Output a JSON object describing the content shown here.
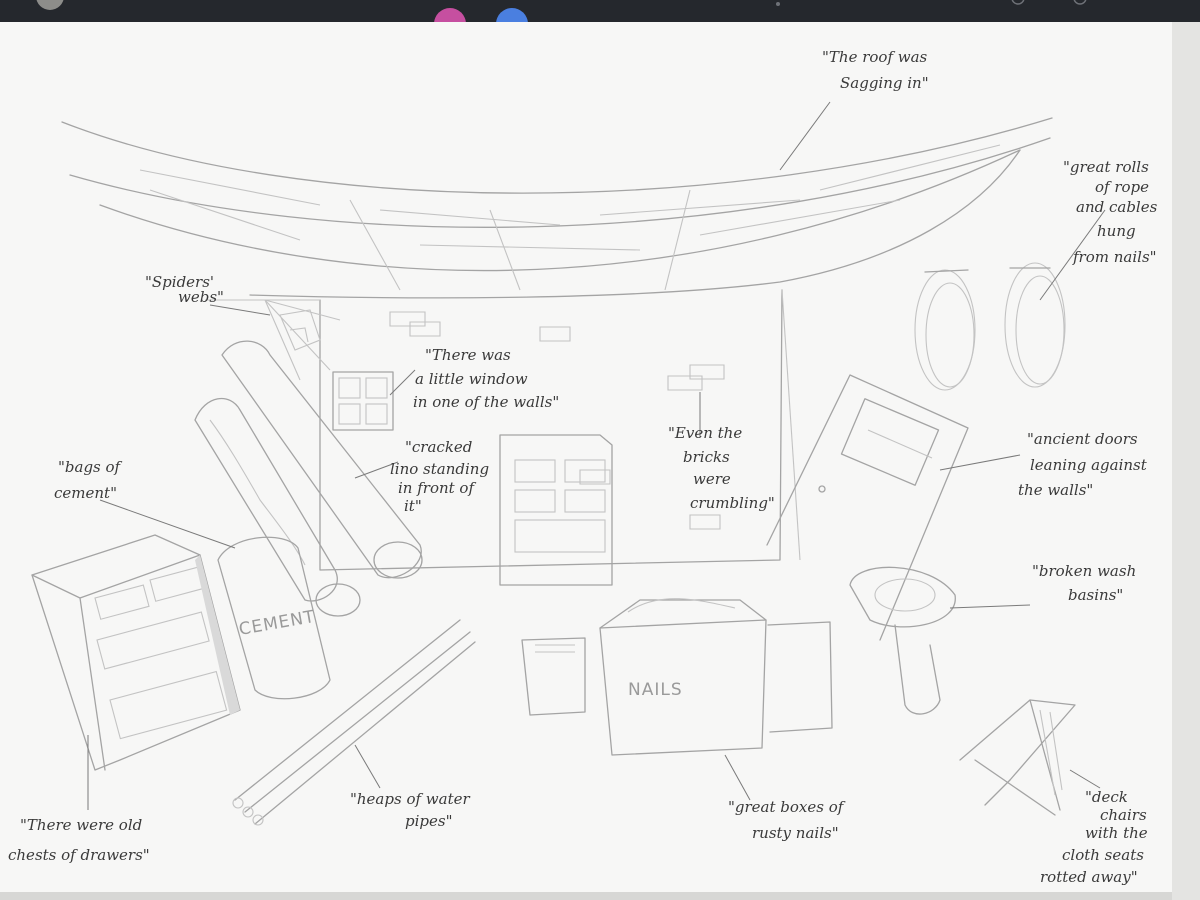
{
  "colors": {
    "paper": "#f7f7f6",
    "pencil": "#a4a4a4",
    "ink": "#3a3a3a",
    "window_bg": "#1f2227",
    "avatar_pink": "#c64fa0",
    "avatar_blue": "#4a7fe0"
  },
  "sketch_labels": {
    "cement": "CEMENT",
    "nails": "NAILS"
  },
  "annotations": {
    "roof": [
      "\"The roof was",
      "Sagging in\""
    ],
    "rope": [
      "\"great rolls",
      "of rope",
      "and cables",
      "hung",
      "from nails\""
    ],
    "webs": [
      "\"Spiders'",
      "webs\""
    ],
    "window": [
      "\"There was",
      "a little window",
      "in one of the walls\""
    ],
    "bricks": [
      "\"Even the",
      "bricks",
      "were",
      "crumbling\""
    ],
    "lino": [
      "\"cracked",
      "lino standing",
      "in front of",
      "it\""
    ],
    "cement": [
      "\"bags of",
      "cement\""
    ],
    "doors": [
      "\"ancient doors",
      "leaning against",
      "the walls\""
    ],
    "basins": [
      "\"broken wash",
      "basins\""
    ],
    "pipes": [
      "\"heaps of water",
      "pipes\""
    ],
    "boxes": [
      "\"great boxes of",
      "rusty nails\""
    ],
    "drawers": [
      "\"There were old",
      "chests of drawers\""
    ],
    "chairs": [
      "\"deck",
      "chairs",
      "with the",
      "cloth seats",
      "rotted away\""
    ]
  }
}
